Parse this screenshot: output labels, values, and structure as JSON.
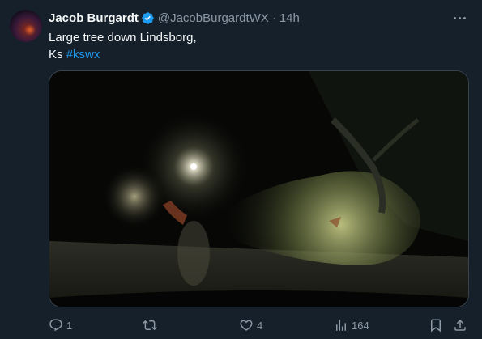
{
  "tweet": {
    "author_name": "Jacob Burgardt",
    "handle": "@JacobBurgardtWX",
    "separator": "·",
    "time": "14h",
    "text_line1": "Large tree down Lindsborg,",
    "text_line2_prefix": "Ks ",
    "hashtag": "#kswx"
  },
  "actions": {
    "replies": "1",
    "retweets": "",
    "likes": "4",
    "views": "164"
  },
  "icons": {
    "verified": "verified-badge-icon",
    "more": "more-icon",
    "reply": "reply-icon",
    "retweet": "retweet-icon",
    "like": "heart-icon",
    "views": "views-icon",
    "bookmark": "bookmark-icon",
    "share": "share-icon"
  },
  "colors": {
    "background": "#15202b",
    "accent": "#1d9bf0",
    "secondary_text": "#8b98a5"
  }
}
